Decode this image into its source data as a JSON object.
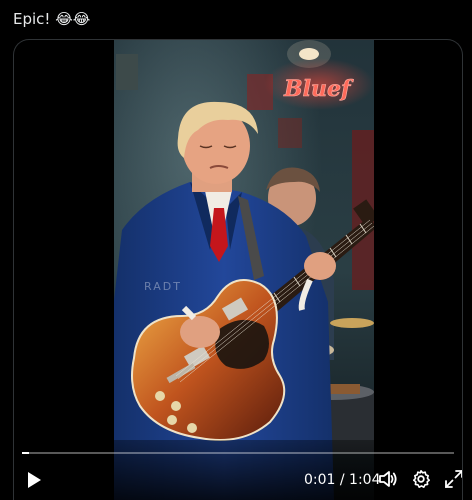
{
  "post": {
    "text": "Epic! 😂😂"
  },
  "video": {
    "neon_sign_text": "Bluef",
    "watermark_text": "RADT",
    "current_time": "0:01",
    "duration": "1:04",
    "time_display": "0:01 / 1:04",
    "progress_fraction": 0.016
  },
  "controls": {
    "play_icon": "play-icon",
    "volume_icon": "volume-icon",
    "settings_icon": "gear-icon",
    "fullscreen_icon": "fullscreen-icon"
  },
  "colors": {
    "background": "#000000",
    "text": "#e7e9ea",
    "neon": "#ff4a3d",
    "suit": "#1d3f86",
    "tie": "#c4161c"
  }
}
